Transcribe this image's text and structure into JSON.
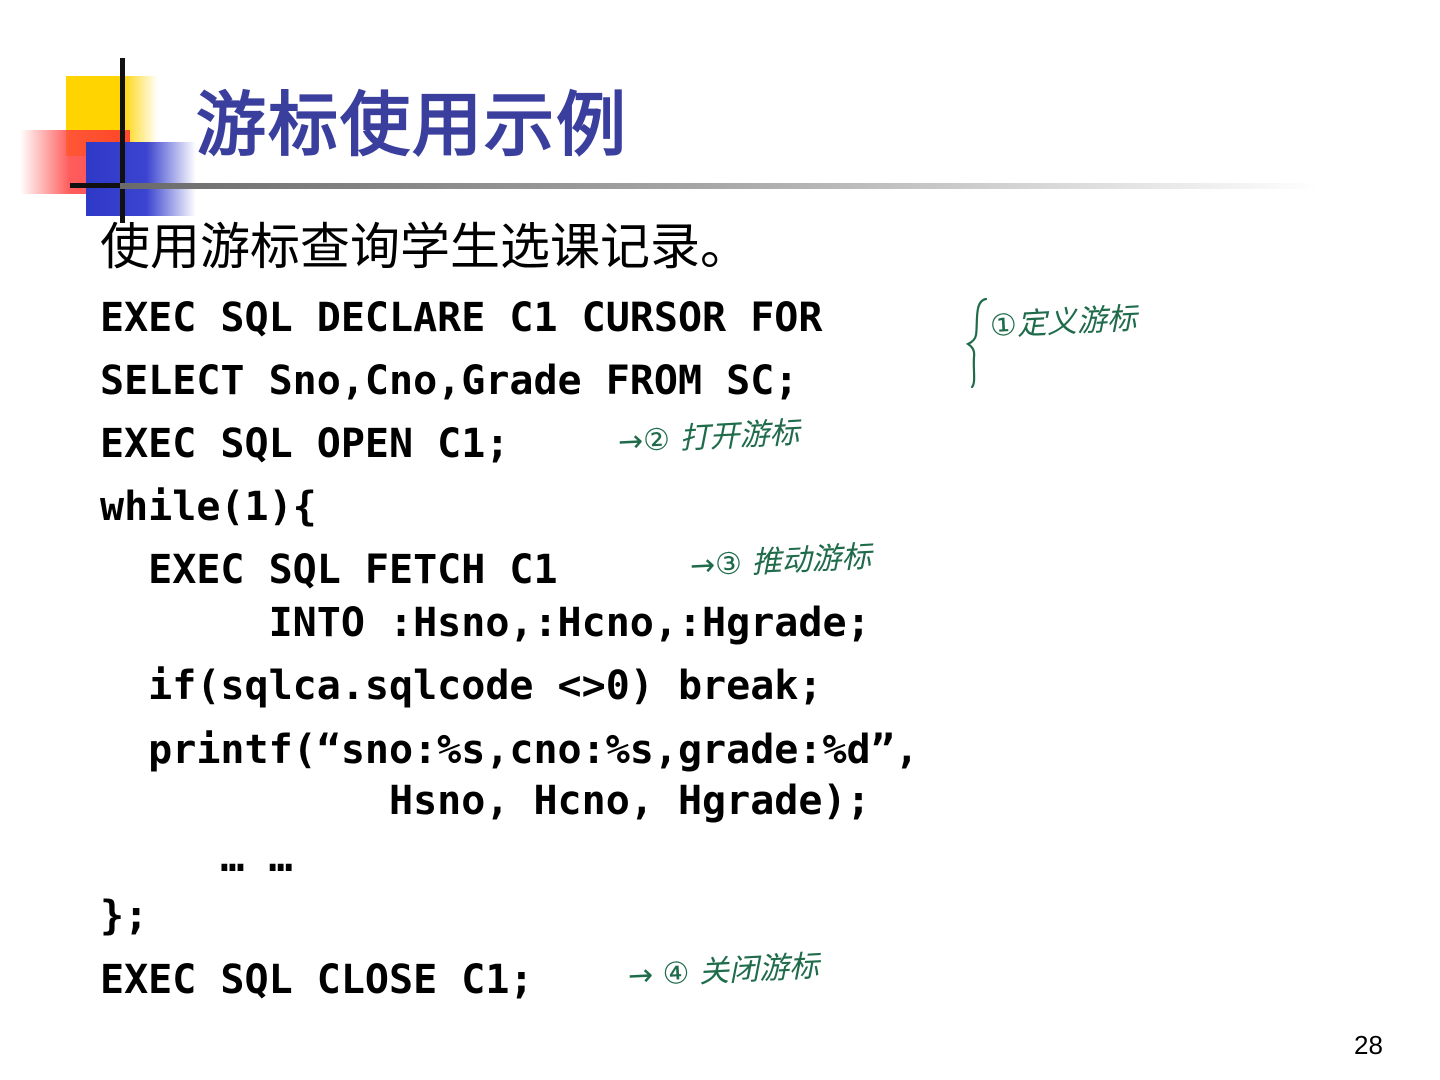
{
  "slide": {
    "title": "游标使用示例",
    "subtitle": "使用游标查询学生选课记录。",
    "code_lines": [
      "EXEC SQL DECLARE C1 CURSOR FOR",
      "SELECT Sno,Cno,Grade FROM SC;",
      "EXEC SQL OPEN C1;",
      "while(1){",
      "  EXEC SQL FETCH C1",
      "       INTO :Hsno,:Hcno,:Hgrade;",
      "  if(sqlca.sqlcode <>0) break;",
      "  printf(“sno:%s,cno:%s,grade:%d”,",
      "            Hsno, Hcno, Hgrade);",
      "     … …",
      "};",
      "EXEC SQL CLOSE C1;"
    ],
    "annotations": {
      "declare": "①定义游标",
      "open": "→② 打开游标",
      "fetch": "→③ 推动游标",
      "close": "→ ④ 关闭游标"
    },
    "page_number": "28"
  },
  "colors": {
    "title": "#3a3f9e",
    "annotation_ink": "#1f6b4a",
    "logo_yellow": "#ffd400",
    "logo_red": "#ff2d2d",
    "logo_blue": "#3b44d0"
  },
  "icons": {
    "logo": "slide-template-logo-squares",
    "brace": "handwritten-brace"
  }
}
